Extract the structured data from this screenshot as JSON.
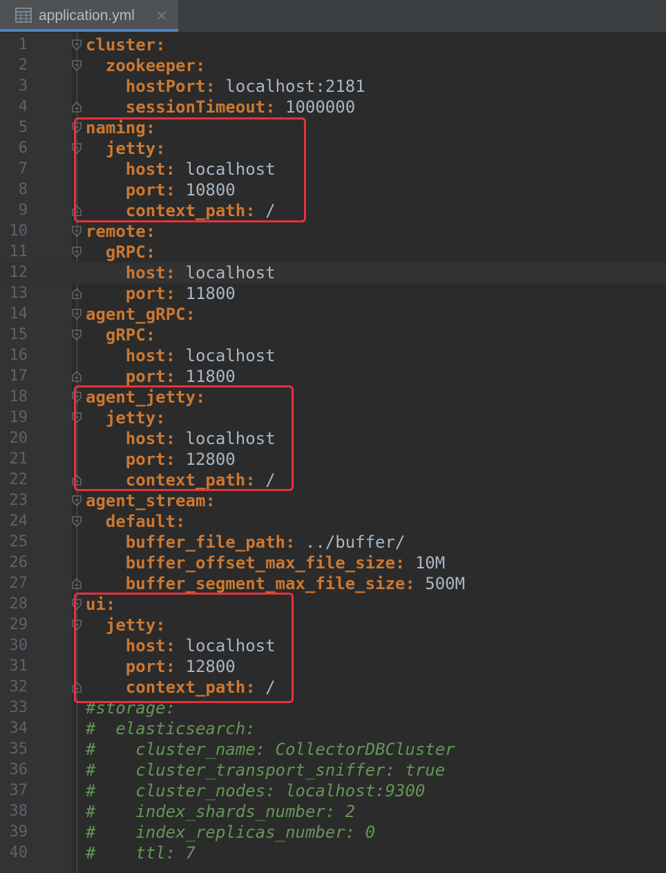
{
  "tab": {
    "filename": "application.yml",
    "icon": "yaml-file-icon",
    "close_icon": "close-icon"
  },
  "colors": {
    "key": "#cc7832",
    "value": "#a9b7c6",
    "comment": "#629755",
    "line_number": "#606366",
    "highlight_box": "#e8323c"
  },
  "lines": [
    {
      "num": "1",
      "indent": "",
      "key": "cluster:",
      "value": "",
      "comment": "",
      "fold": "open"
    },
    {
      "num": "2",
      "indent": "  ",
      "key": "zookeeper:",
      "value": "",
      "comment": "",
      "fold": "open"
    },
    {
      "num": "3",
      "indent": "    ",
      "key": "hostPort:",
      "value": " localhost:2181",
      "comment": "",
      "fold": ""
    },
    {
      "num": "4",
      "indent": "    ",
      "key": "sessionTimeout:",
      "value": " 1000000",
      "comment": "",
      "fold": "close"
    },
    {
      "num": "5",
      "indent": "",
      "key": "naming:",
      "value": "",
      "comment": "",
      "fold": "open"
    },
    {
      "num": "6",
      "indent": "  ",
      "key": "jetty:",
      "value": "",
      "comment": "",
      "fold": "open"
    },
    {
      "num": "7",
      "indent": "    ",
      "key": "host:",
      "value": " localhost",
      "comment": "",
      "fold": ""
    },
    {
      "num": "8",
      "indent": "    ",
      "key": "port:",
      "value": " 10800",
      "comment": "",
      "fold": ""
    },
    {
      "num": "9",
      "indent": "    ",
      "key": "context_path:",
      "value": " /",
      "comment": "",
      "fold": "close"
    },
    {
      "num": "10",
      "indent": "",
      "key": "remote:",
      "value": "",
      "comment": "",
      "fold": "open"
    },
    {
      "num": "11",
      "indent": "  ",
      "key": "gRPC:",
      "value": "",
      "comment": "",
      "fold": "open"
    },
    {
      "num": "12",
      "indent": "    ",
      "key": "host:",
      "value": " localhost",
      "comment": "",
      "fold": "",
      "current": true
    },
    {
      "num": "13",
      "indent": "    ",
      "key": "port:",
      "value": " 11800",
      "comment": "",
      "fold": "close"
    },
    {
      "num": "14",
      "indent": "",
      "key": "agent_gRPC:",
      "value": "",
      "comment": "",
      "fold": "open"
    },
    {
      "num": "15",
      "indent": "  ",
      "key": "gRPC:",
      "value": "",
      "comment": "",
      "fold": "open"
    },
    {
      "num": "16",
      "indent": "    ",
      "key": "host:",
      "value": " localhost",
      "comment": "",
      "fold": ""
    },
    {
      "num": "17",
      "indent": "    ",
      "key": "port:",
      "value": " 11800",
      "comment": "",
      "fold": "close"
    },
    {
      "num": "18",
      "indent": "",
      "key": "agent_jetty:",
      "value": "",
      "comment": "",
      "fold": "open"
    },
    {
      "num": "19",
      "indent": "  ",
      "key": "jetty:",
      "value": "",
      "comment": "",
      "fold": "open"
    },
    {
      "num": "20",
      "indent": "    ",
      "key": "host:",
      "value": " localhost",
      "comment": "",
      "fold": ""
    },
    {
      "num": "21",
      "indent": "    ",
      "key": "port:",
      "value": " 12800",
      "comment": "",
      "fold": ""
    },
    {
      "num": "22",
      "indent": "    ",
      "key": "context_path:",
      "value": " /",
      "comment": "",
      "fold": "close"
    },
    {
      "num": "23",
      "indent": "",
      "key": "agent_stream:",
      "value": "",
      "comment": "",
      "fold": "open"
    },
    {
      "num": "24",
      "indent": "  ",
      "key": "default:",
      "value": "",
      "comment": "",
      "fold": "open"
    },
    {
      "num": "25",
      "indent": "    ",
      "key": "buffer_file_path:",
      "value": " ../buffer/",
      "comment": "",
      "fold": ""
    },
    {
      "num": "26",
      "indent": "    ",
      "key": "buffer_offset_max_file_size:",
      "value": " 10M",
      "comment": "",
      "fold": ""
    },
    {
      "num": "27",
      "indent": "    ",
      "key": "buffer_segment_max_file_size:",
      "value": " 500M",
      "comment": "",
      "fold": "close"
    },
    {
      "num": "28",
      "indent": "",
      "key": "ui:",
      "value": "",
      "comment": "",
      "fold": "open"
    },
    {
      "num": "29",
      "indent": "  ",
      "key": "jetty:",
      "value": "",
      "comment": "",
      "fold": "open"
    },
    {
      "num": "30",
      "indent": "    ",
      "key": "host:",
      "value": " localhost",
      "comment": "",
      "fold": ""
    },
    {
      "num": "31",
      "indent": "    ",
      "key": "port:",
      "value": " 12800",
      "comment": "",
      "fold": ""
    },
    {
      "num": "32",
      "indent": "    ",
      "key": "context_path:",
      "value": " /",
      "comment": "",
      "fold": "close"
    },
    {
      "num": "33",
      "indent": "",
      "key": "",
      "value": "",
      "comment": "#storage:",
      "fold": ""
    },
    {
      "num": "34",
      "indent": "",
      "key": "",
      "value": "",
      "comment": "#  elasticsearch:",
      "fold": ""
    },
    {
      "num": "35",
      "indent": "",
      "key": "",
      "value": "",
      "comment": "#    cluster_name: CollectorDBCluster",
      "fold": ""
    },
    {
      "num": "36",
      "indent": "",
      "key": "",
      "value": "",
      "comment": "#    cluster_transport_sniffer: true",
      "fold": ""
    },
    {
      "num": "37",
      "indent": "",
      "key": "",
      "value": "",
      "comment": "#    cluster_nodes: localhost:9300",
      "fold": ""
    },
    {
      "num": "38",
      "indent": "",
      "key": "",
      "value": "",
      "comment": "#    index_shards_number: 2",
      "fold": ""
    },
    {
      "num": "39",
      "indent": "",
      "key": "",
      "value": "",
      "comment": "#    index_replicas_number: 0",
      "fold": ""
    },
    {
      "num": "40",
      "indent": "",
      "key": "",
      "value": "",
      "comment": "#    ttl: 7",
      "fold": ""
    }
  ]
}
